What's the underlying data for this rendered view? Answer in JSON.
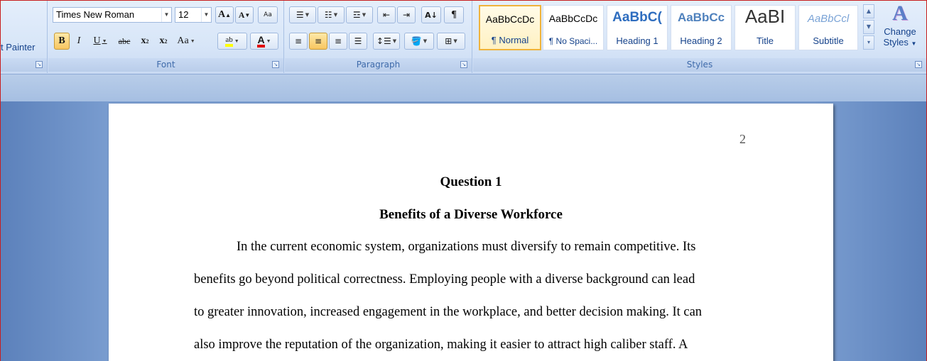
{
  "ribbon": {
    "clipboard": {
      "format_painter_label": "t Painter"
    },
    "font": {
      "group_label": "Font",
      "font_name": "Times New Roman",
      "font_size": "12",
      "grow_label": "A",
      "shrink_label": "A",
      "clear_label": "Aa",
      "bold": "B",
      "italic": "I",
      "underline": "U",
      "strike": "abc",
      "subscript": "x",
      "superscript": "x",
      "change_case": "Aa",
      "highlight": "ab",
      "font_color": "A"
    },
    "paragraph": {
      "group_label": "Paragraph",
      "sort_label": "A↓",
      "pilcrow": "¶"
    },
    "styles": {
      "group_label": "Styles",
      "items": [
        {
          "sample": "AaBbCcDc",
          "name": "¶ Normal"
        },
        {
          "sample": "AaBbCcDc",
          "name": "¶ No Spaci..."
        },
        {
          "sample": "AaBbC(",
          "name": "Heading 1"
        },
        {
          "sample": "AaBbCc",
          "name": "Heading 2"
        },
        {
          "sample": "AaBI",
          "name": "Title"
        },
        {
          "sample": "AaBbCcl",
          "name": "Subtitle"
        }
      ],
      "change_styles_line1": "Change",
      "change_styles_line2": "Styles"
    }
  },
  "document": {
    "page_number": "2",
    "title": "Question 1",
    "subtitle": "Benefits of a Diverse Workforce",
    "lines": [
      "In the current economic system, organizations must diversify to remain competitive. Its",
      "benefits go beyond political correctness. Employing people with a diverse background can lead",
      "to greater innovation, increased engagement in the workplace, and better decision making. It can",
      "also improve the reputation of the organization, making it easier to attract high caliber staff. A"
    ]
  },
  "colors": {
    "accent": "#15428b",
    "selected_style": "#f0b33b",
    "font_color_bar": "#e00000",
    "highlight_bar": "#ffff00"
  }
}
